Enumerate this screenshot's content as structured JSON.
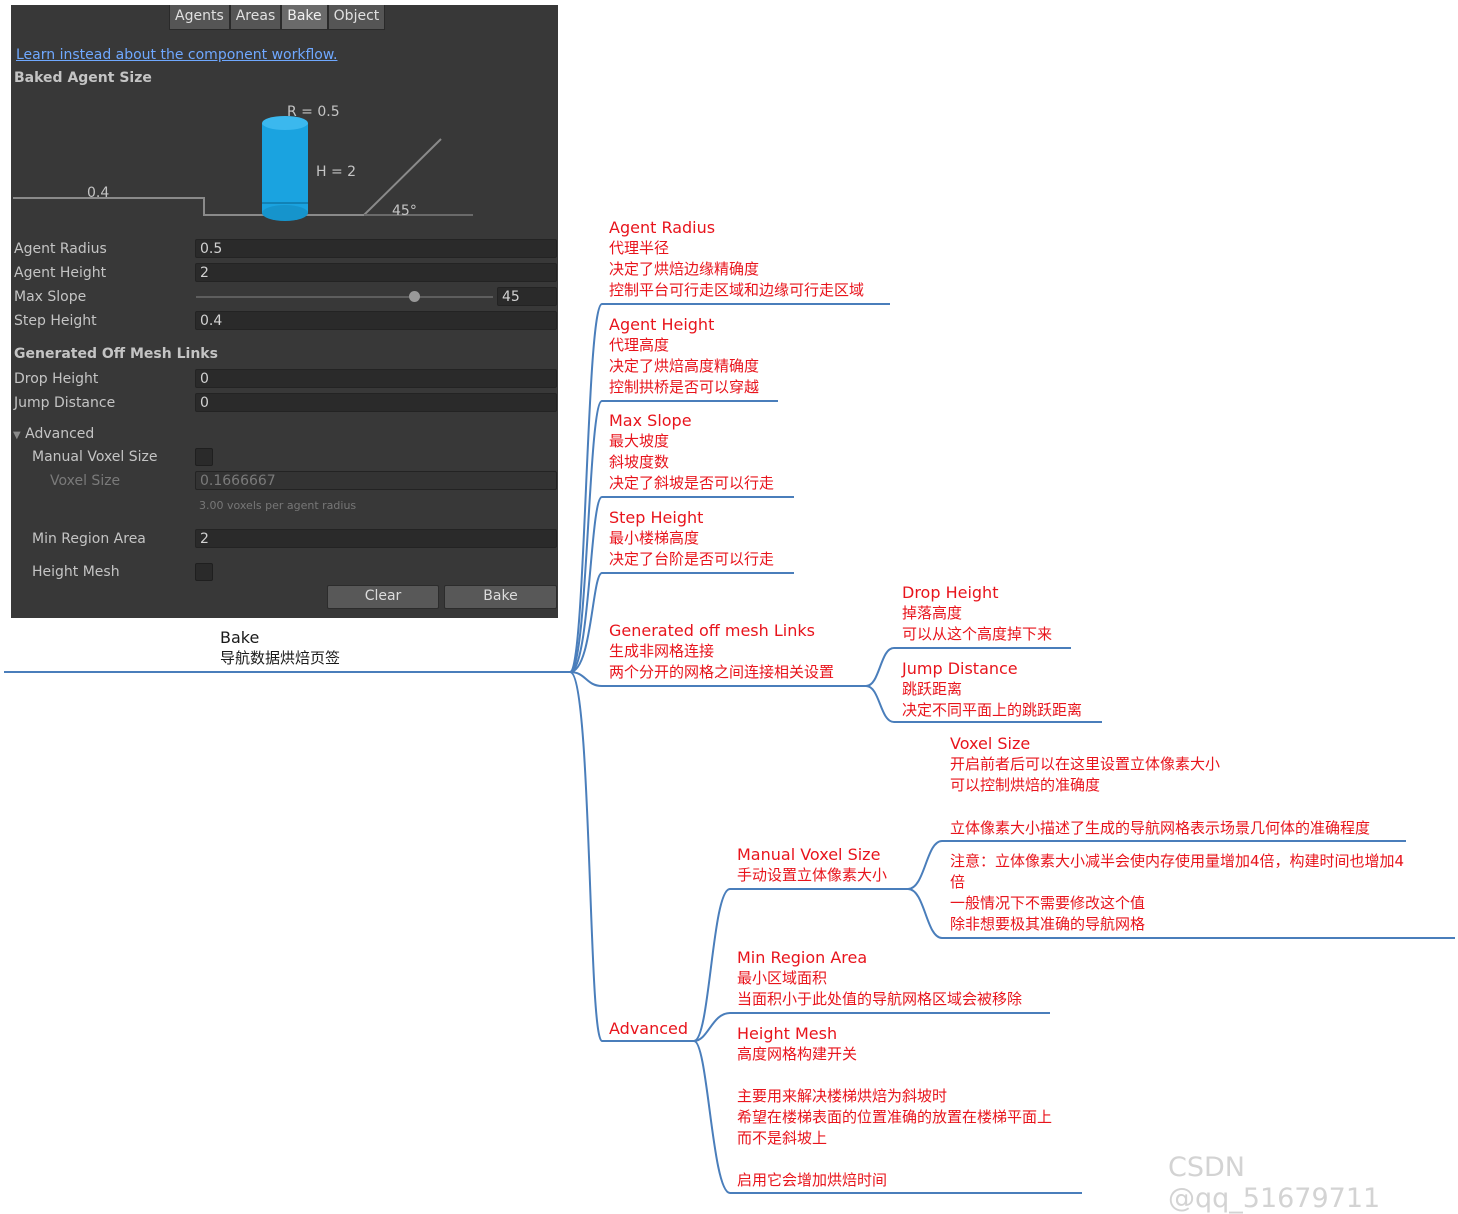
{
  "tabs": [
    "Agents",
    "Areas",
    "Bake",
    "Object"
  ],
  "active_tab": "Bake",
  "link_text": "Learn instead about the component workflow.",
  "section_baked": "Baked Agent Size",
  "diagram": {
    "r_label": "R = 0.5",
    "h_label": "H = 2",
    "step_label": "0.4",
    "angle_label": "45°"
  },
  "fields": {
    "agent_radius": {
      "label": "Agent Radius",
      "value": "0.5"
    },
    "agent_height": {
      "label": "Agent Height",
      "value": "2"
    },
    "max_slope": {
      "label": "Max Slope",
      "value": "45"
    },
    "step_height": {
      "label": "Step Height",
      "value": "0.4"
    }
  },
  "section_links": "Generated Off Mesh Links",
  "links_fields": {
    "drop_height": {
      "label": "Drop Height",
      "value": "0"
    },
    "jump_distance": {
      "label": "Jump Distance",
      "value": "0"
    }
  },
  "advanced": {
    "label": "Advanced",
    "manual_voxel": "Manual Voxel Size",
    "voxel_size_label": "Voxel Size",
    "voxel_size_value": "0.1666667",
    "voxel_hint": "3.00 voxels per agent radius",
    "min_region_label": "Min Region Area",
    "min_region_value": "2",
    "height_mesh": "Height Mesh"
  },
  "buttons": {
    "clear": "Clear",
    "bake": "Bake"
  },
  "mindmap": {
    "root": [
      "Bake",
      "导航数据烘焙页签"
    ],
    "agent_radius": [
      "Agent Radius",
      "代理半径",
      "决定了烘焙边缘精确度",
      "控制平台可行走区域和边缘可行走区域"
    ],
    "agent_height": [
      "Agent Height",
      "代理高度",
      "决定了烘焙高度精确度",
      "控制拱桥是否可以穿越"
    ],
    "max_slope": [
      "Max Slope",
      "最大坡度",
      "斜坡度数",
      "决定了斜坡是否可以行走"
    ],
    "step_height": [
      "Step Height",
      "最小楼梯高度",
      "决定了台阶是否可以行走"
    ],
    "off_mesh": [
      "Generated off mesh Links",
      "生成非网格连接",
      "两个分开的网格之间连接相关设置"
    ],
    "drop_height": [
      "Drop Height",
      "掉落高度",
      "可以从这个高度掉下来"
    ],
    "jump_distance": [
      "Jump Distance",
      "跳跃距离",
      "决定不同平面上的跳跃距离"
    ],
    "voxel_size": [
      "Voxel Size",
      "开启前者后可以在这里设置立体像素大小",
      "可以控制烘焙的准确度"
    ],
    "voxel_desc": [
      "立体像素大小描述了生成的导航网格表示场景几何体的准确程度"
    ],
    "voxel_note": [
      "注意：立体像素大小减半会使内存使用量增加4倍，构建时间也增加4",
      "倍",
      "一般情况下不需要修改这个值",
      "除非想要极其准确的导航网格"
    ],
    "manual_voxel": [
      "Manual Voxel Size",
      "手动设置立体像素大小"
    ],
    "min_region": [
      "Min Region Area",
      "最小区域面积",
      "当面积小于此处值的导航网格区域会被移除"
    ],
    "height_mesh": [
      "Height Mesh",
      "高度网格构建开关",
      "",
      "主要用来解决楼梯烘焙为斜坡时",
      "希望在楼梯表面的位置准确的放置在楼梯平面上",
      "而不是斜坡上",
      "",
      "启用它会增加烘焙时间"
    ],
    "advanced": [
      "Advanced"
    ]
  },
  "watermark": "CSDN @qq_51679711",
  "colors": {
    "line": "#4a7ebb",
    "node_text": "#e8141c",
    "panel_bg": "#383838"
  }
}
